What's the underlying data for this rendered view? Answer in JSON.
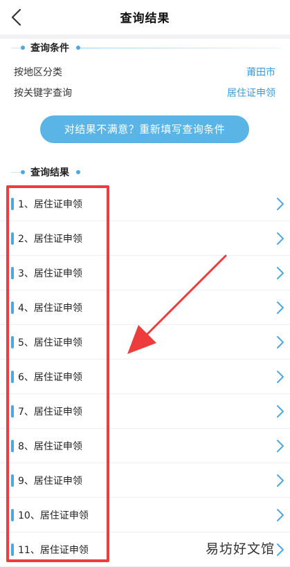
{
  "header": {
    "title": "查询结果"
  },
  "conditions": {
    "section_title": "查询条件",
    "rows": [
      {
        "key": "按地区分类",
        "value": "莆田市"
      },
      {
        "key": "按关键字查询",
        "value": "居住证申领"
      }
    ]
  },
  "requery_label": "对结果不满意？重新填写查询条件",
  "results": {
    "section_title": "查询结果",
    "items": [
      "1、居住证申领",
      "2、居住证申领",
      "3、居住证申领",
      "4、居住证申领",
      "5、居住证申领",
      "6、居住证申领",
      "7、居住证申领",
      "8、居住证申领",
      "9、居住证申领",
      "10、居住证申领",
      "11、居住证申领"
    ]
  },
  "watermark": "易坊好文馆",
  "colors": {
    "accent": "#4ea8e0",
    "button": "#5ab4e6",
    "highlight": "#ee3b3b"
  },
  "icons": {
    "back": "chevron-left-icon",
    "row": "chevron-right-icon"
  }
}
